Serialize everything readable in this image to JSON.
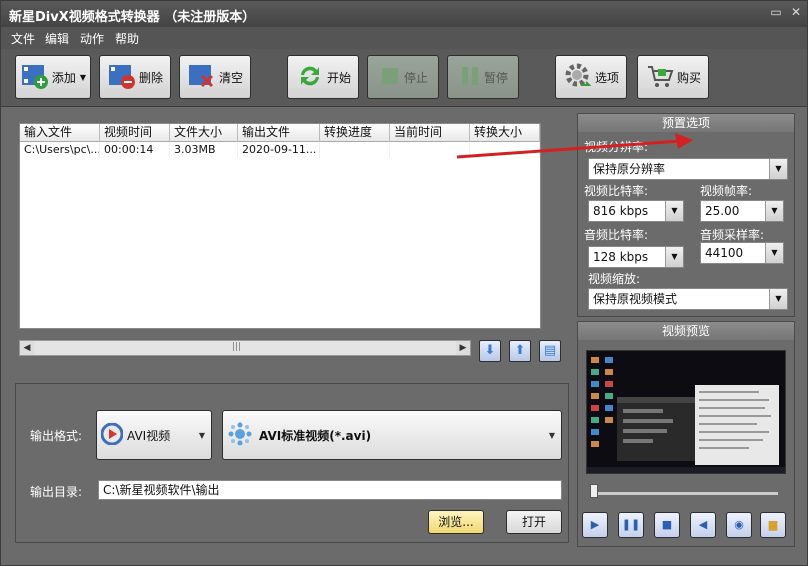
{
  "window": {
    "title": "新星DivX视频格式转换器 （未注册版本）",
    "controls": {
      "minimize": "▭",
      "close": "✕"
    }
  },
  "menu": [
    "文件",
    "编辑",
    "动作",
    "帮助"
  ],
  "toolbar": {
    "add": "添加",
    "delete": "删除",
    "clear": "清空",
    "start": "开始",
    "stop": "停止",
    "pause": "暂停",
    "options": "选项",
    "buy": "购买"
  },
  "file_table": {
    "columns": [
      "输入文件",
      "视频时间",
      "文件大小",
      "输出文件",
      "转换进度",
      "当前时间",
      "转换大小"
    ],
    "rows": [
      [
        "C:\\Users\\pc\\...",
        "00:00:14",
        "3.03MB",
        "2020-09-11...",
        "",
        "",
        ""
      ]
    ],
    "scroll_grip": "|||"
  },
  "output": {
    "format_label": "输出格式:",
    "format_value": "AVI视频",
    "profile_value": "AVI标准视频(*.avi)",
    "dir_label": "输出目录:",
    "dir_value": "C:\\新星视频软件\\输出",
    "browse": "浏览...",
    "open": "打开"
  },
  "presets": {
    "header": "预置选项",
    "resolution_label": "视频分辨率:",
    "resolution_value": "保持原分辨率",
    "video_bitrate_label": "视频比特率:",
    "video_bitrate_value": "816 kbps",
    "framerate_label": "视频帧率:",
    "framerate_value": "25.00",
    "audio_bitrate_label": "音频比特率:",
    "audio_bitrate_value": "128 kbps",
    "samplerate_label": "音频采样率:",
    "samplerate_value": "44100",
    "scale_label": "视频缩放:",
    "scale_value": "保持原视频模式"
  },
  "preview": {
    "header": "视频预览"
  },
  "colors": {
    "panel": "#6b6b6b",
    "accent_blue": "#3a7bd5",
    "annotation_red": "#d42020"
  }
}
